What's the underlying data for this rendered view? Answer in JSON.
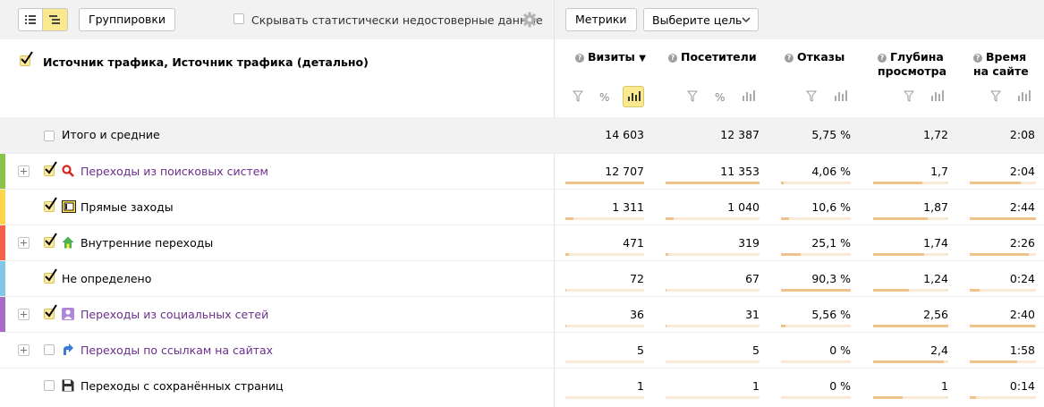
{
  "toolbar": {
    "groupings_label": "Группировки",
    "hide_unreliable_label": "Скрывать статистически недостоверные данные",
    "metrics_label": "Метрики",
    "goal_select_label": "Выберите цель"
  },
  "table": {
    "dimension_header": "Источник трафика, Источник трафика (детально)",
    "columns": [
      {
        "key": "visits",
        "line1": "Визиты",
        "line2": "",
        "sorted": "▼"
      },
      {
        "key": "visitors",
        "line1": "Посетители",
        "line2": ""
      },
      {
        "key": "bounce",
        "line1": "Отказы",
        "line2": ""
      },
      {
        "key": "depth",
        "line1": "Глубина",
        "line2": "просмотра"
      },
      {
        "key": "time",
        "line1": "Время",
        "line2": "на сайте"
      }
    ],
    "percent_glyph": "%",
    "totals": {
      "label": "Итого и средние",
      "visits": "14 603",
      "visitors": "12 387",
      "bounce": "5,75 %",
      "depth": "1,72",
      "time": "2:08"
    },
    "rows": [
      {
        "label": "Переходы из поисковых систем",
        "visits": "12 707",
        "visitors": "11 353",
        "bounce": "4,06 %",
        "depth": "1,7",
        "time": "2:04",
        "icon": "search-icon",
        "color": "#8bc34a",
        "link": true,
        "checked": true,
        "expandable": true,
        "levels": {
          "visits": 1.0,
          "visitors": 1.0,
          "bounce": 0.04,
          "depth": 0.66,
          "time": 0.77
        }
      },
      {
        "label": "Прямые заходы",
        "visits": "1 311",
        "visitors": "1 040",
        "bounce": "10,6 %",
        "depth": "1,87",
        "time": "2:44",
        "icon": "direct-entry-icon",
        "color": "#ffd54f",
        "link": false,
        "checked": true,
        "expandable": false,
        "levels": {
          "visits": 0.1,
          "visitors": 0.09,
          "bounce": 0.12,
          "depth": 0.73,
          "time": 1.0
        }
      },
      {
        "label": "Внутренние переходы",
        "visits": "471",
        "visitors": "319",
        "bounce": "25,1 %",
        "depth": "1,74",
        "time": "2:26",
        "icon": "home-icon",
        "color": "#f4614a",
        "link": false,
        "checked": true,
        "expandable": true,
        "levels": {
          "visits": 0.04,
          "visitors": 0.03,
          "bounce": 0.28,
          "depth": 0.68,
          "time": 0.89
        }
      },
      {
        "label": "Не определено",
        "visits": "72",
        "visitors": "67",
        "bounce": "90,3 %",
        "depth": "1,24",
        "time": "0:24",
        "icon": "",
        "color": "#81c7ea",
        "link": false,
        "checked": true,
        "expandable": false,
        "levels": {
          "visits": 0.006,
          "visitors": 0.006,
          "bounce": 1.0,
          "depth": 0.48,
          "time": 0.15
        }
      },
      {
        "label": "Переходы из социальных сетей",
        "visits": "36",
        "visitors": "31",
        "bounce": "5,56 %",
        "depth": "2,56",
        "time": "2:40",
        "icon": "user-icon",
        "color": "#a86bc7",
        "link": true,
        "checked": true,
        "expandable": true,
        "levels": {
          "visits": 0.003,
          "visitors": 0.003,
          "bounce": 0.06,
          "depth": 1.0,
          "time": 0.98
        }
      },
      {
        "label": "Переходы по ссылкам на сайтах",
        "visits": "5",
        "visitors": "5",
        "bounce": "0 %",
        "depth": "2,4",
        "time": "1:58",
        "icon": "link-arrow-icon",
        "color": "",
        "link": true,
        "checked": false,
        "expandable": true,
        "levels": {
          "visits": 0.0,
          "visitors": 0.0,
          "bounce": 0.0,
          "depth": 0.94,
          "time": 0.72
        }
      },
      {
        "label": "Переходы с сохранённых страниц",
        "visits": "1",
        "visitors": "1",
        "bounce": "0 %",
        "depth": "1",
        "time": "0:14",
        "icon": "floppy-icon",
        "color": "",
        "link": false,
        "checked": false,
        "expandable": false,
        "levels": {
          "visits": 0.0,
          "visitors": 0.0,
          "bounce": 0.0,
          "depth": 0.39,
          "time": 0.09
        }
      }
    ]
  }
}
